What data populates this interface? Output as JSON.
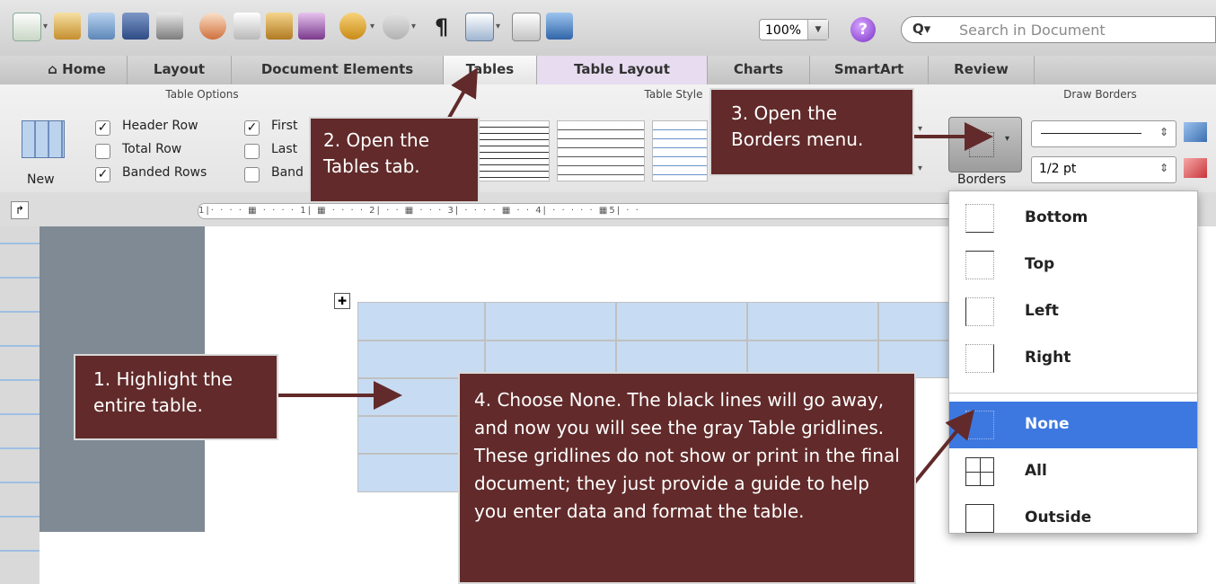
{
  "toolbar": {
    "zoom_value": "100%",
    "search_placeholder": "Search in Document",
    "search_prefix": "Q▾",
    "help_glyph": "?",
    "pilcrow": "¶"
  },
  "tabs": [
    "Home",
    "Layout",
    "Document Elements",
    "Tables",
    "Table Layout",
    "Charts",
    "SmartArt",
    "Review"
  ],
  "ribbon": {
    "table_options_title": "Table Options",
    "new_label": "New",
    "options": [
      {
        "label": "Header Row",
        "checked": true
      },
      {
        "label": "Total Row",
        "checked": false
      },
      {
        "label": "Banded Rows",
        "checked": true
      },
      {
        "label": "First",
        "checked": true
      },
      {
        "label": "Last",
        "checked": false
      },
      {
        "label": "Band",
        "checked": false
      }
    ],
    "table_styles_title": "Table Style",
    "draw_borders_title": "Draw Borders",
    "borders_label": "Borders",
    "line_weight": "1/2 pt"
  },
  "ruler_text": "1|· · · · ▦ · · · · 1| ▦ · · · · 2| · · ▦ · · · 3| · · · · ▦ · · 4| · · · · · ▦5| · ·",
  "borders_menu": {
    "items": [
      "Bottom",
      "Top",
      "Left",
      "Right",
      "None",
      "All",
      "Outside"
    ],
    "selected": "None",
    "highlight_color": "#3d78e0"
  },
  "callouts": {
    "step1": "1. Highlight the entire table.",
    "step2": "2. Open the Tables tab.",
    "step3": "3. Open the Borders menu.",
    "step4": "4. Choose None. The black lines will go away, and now you will see the gray Table gridlines. These gridlines do not show or print in the final document; they just provide a guide to help you enter data and format the table."
  },
  "colors": {
    "callout_bg": "#622a2a",
    "table_fill": "#c7dcf2",
    "active_tab": "#e7dcf0"
  }
}
